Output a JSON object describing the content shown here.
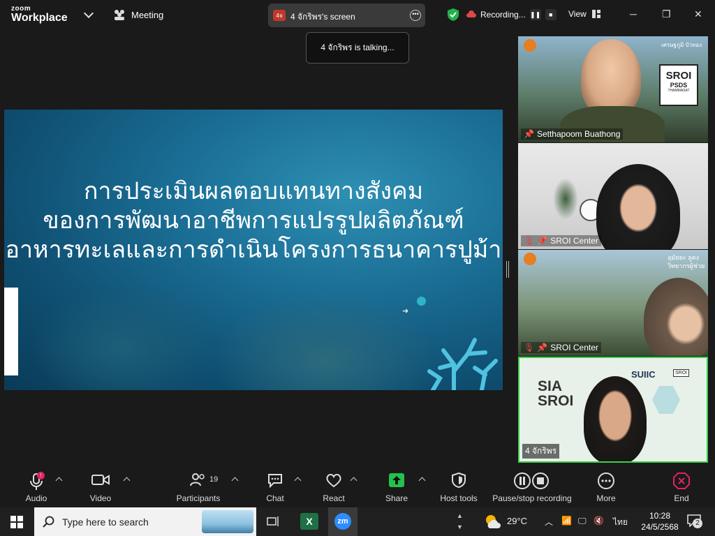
{
  "app": {
    "brand_small": "zoom",
    "brand_big": "Workplace",
    "meeting_label": "Meeting"
  },
  "screen_share": {
    "avatar": "4จ",
    "label": "4 จักริพร's screen"
  },
  "recording": {
    "label": "Recording..."
  },
  "view": {
    "label": "View"
  },
  "toast": {
    "text": "4 จักริพร is talking..."
  },
  "slide": {
    "line1": "การประเมินผลตอบแทนทางสังคม",
    "line2": "ของการพัฒนาอาชีพการแปรรูปผลิตภัณฑ์",
    "line3": "อาหารทะเลและการดำเนินโครงการธนาคารปูม้า"
  },
  "tiles": [
    {
      "name": "Setthapoom Buathong",
      "badge_a": "SROI",
      "badge_b": "PSDS",
      "badge_c": "THAMMASAT",
      "header": "เศรษฐภูมิ บัวทอง"
    },
    {
      "name": "SROI Center"
    },
    {
      "name": "SROI Center",
      "header": "อุมัยยะ ลูตง",
      "header2": "วิทยากรผู้ช่วย"
    },
    {
      "name": "4 จักริพร",
      "sia": "SIA",
      "sroi": "SROI",
      "suic": "SUIIC",
      "badge": "SROI"
    }
  ],
  "toolbar": {
    "audio": "Audio",
    "audio_alert": "!",
    "video": "Video",
    "participants": "Participants",
    "participants_count": "19",
    "chat": "Chat",
    "react": "React",
    "share": "Share",
    "host_tools": "Host tools",
    "pause_stop": "Pause/stop recording",
    "more": "More",
    "end": "End"
  },
  "taskbar": {
    "search_placeholder": "Type here to search",
    "temperature": "29°C",
    "language": "ไทย",
    "time": "10:28",
    "date": "24/5/2568",
    "notifications": "2"
  }
}
